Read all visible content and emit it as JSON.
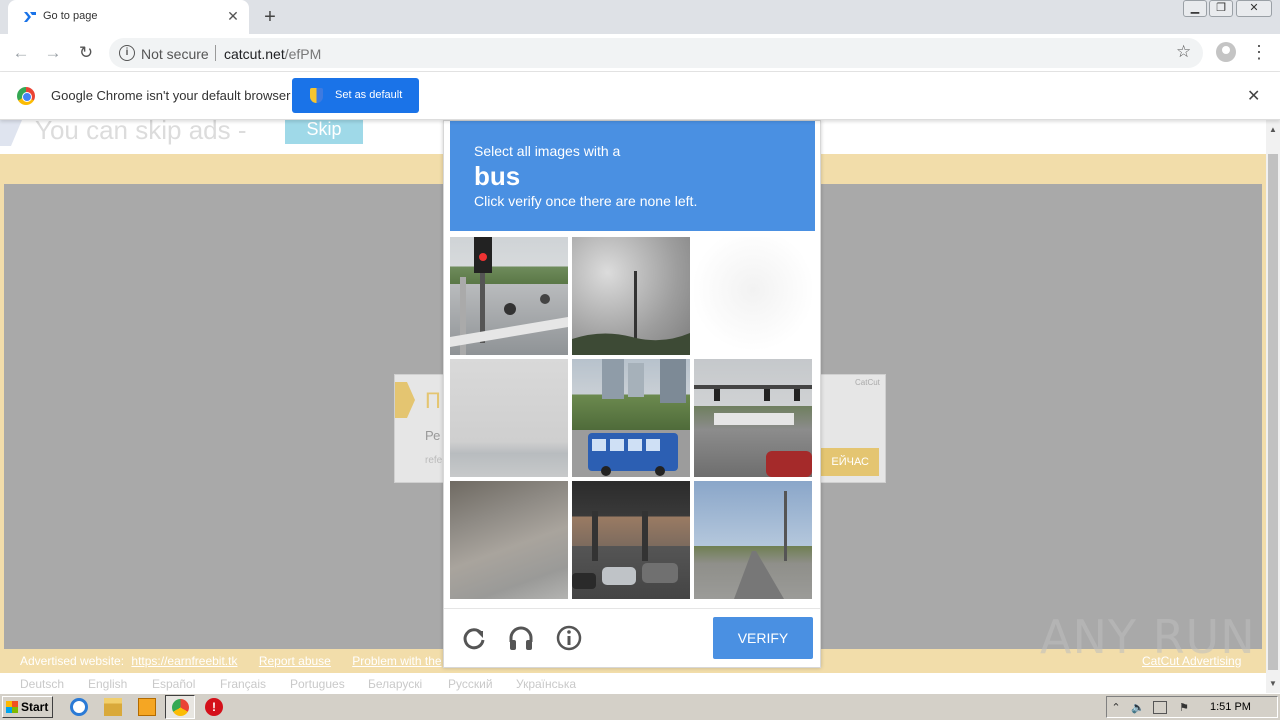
{
  "browser": {
    "tab_title": "Go to page",
    "new_tab": "+",
    "nav": {
      "back": "←",
      "forward": "→",
      "reload": "↻"
    },
    "security_label": "Not secure",
    "url_host": "catcut.net",
    "url_path": "/efPM",
    "window_controls": {
      "minimize": "▁",
      "restore": "❐",
      "close": "✕"
    }
  },
  "infobar": {
    "message": "Google Chrome isn't your default browser",
    "button_label": "Set as default",
    "close": "✕"
  },
  "page": {
    "skip_text": "You can skip ads  -",
    "skip_button": "Skip",
    "ad": {
      "title": "П",
      "line1": "Ре",
      "line2": "refe",
      "brand": "CatCut",
      "cta": "ЕЙЧАС"
    },
    "footer": {
      "advertised_label": "Advertised website:",
      "advertised_link": "https://earnfreebit.tk",
      "report": "Report abuse",
      "problem": "Problem with the",
      "right_link": "CatCut Advertising"
    },
    "languages": [
      "Deutsch",
      "English",
      "Español",
      "Français",
      "Portugues",
      "Беларускі",
      "Русский",
      "Українська"
    ]
  },
  "captcha": {
    "instruction_line1": "Select all images with a",
    "target_word": "bus",
    "instruction_line3": "Click verify once there are none left.",
    "verify_label": "VERIFY",
    "tiles": [
      {
        "name": "tile-traffic-light-street",
        "selected": false
      },
      {
        "name": "tile-cloudy-sky-tower",
        "selected": false
      },
      {
        "name": "tile-blank-fading",
        "selected": false
      },
      {
        "name": "tile-foggy-road",
        "selected": false
      },
      {
        "name": "tile-blue-trolley-bus",
        "selected": false
      },
      {
        "name": "tile-highway-intersection",
        "selected": false
      },
      {
        "name": "tile-concrete-wall",
        "selected": false
      },
      {
        "name": "tile-overpass-parking",
        "selected": false
      },
      {
        "name": "tile-road-trees",
        "selected": false
      }
    ]
  },
  "watermark": "ANY RUN",
  "taskbar": {
    "start_label": "Start",
    "clock": "1:51 PM"
  }
}
